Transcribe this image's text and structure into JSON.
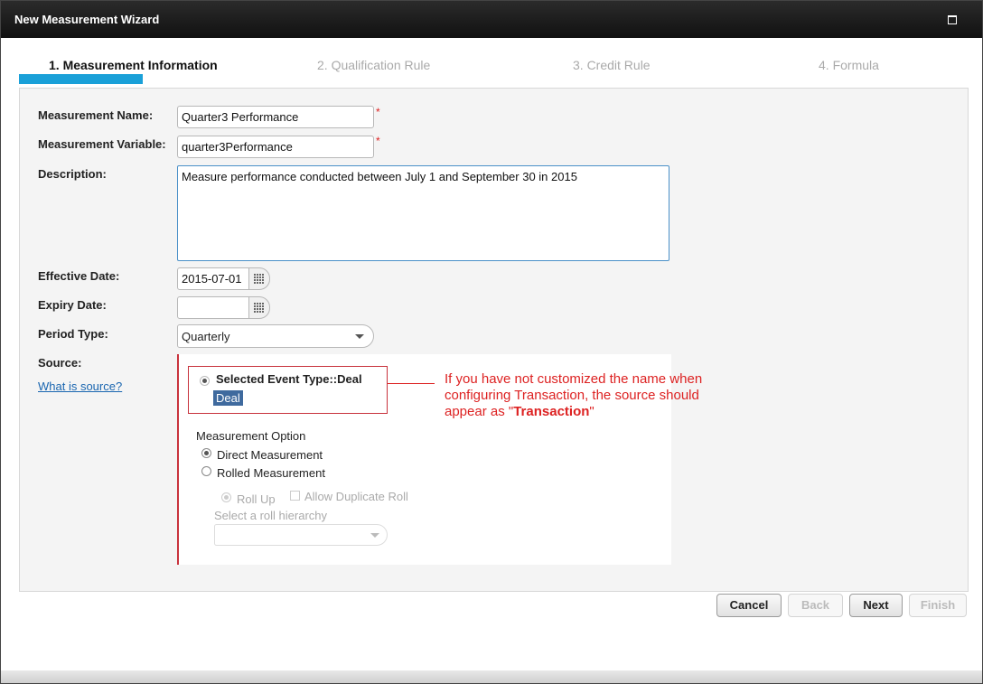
{
  "window": {
    "title": "New Measurement Wizard"
  },
  "steps": [
    {
      "label": "1. Measurement Information",
      "active": true
    },
    {
      "label": "2. Qualification Rule",
      "active": false
    },
    {
      "label": "3. Credit Rule",
      "active": false
    },
    {
      "label": "4. Formula",
      "active": false
    }
  ],
  "form": {
    "measurement_name": {
      "label": "Measurement Name:",
      "value": "Quarter3 Performance",
      "required_mark": "*"
    },
    "measurement_variable": {
      "label": "Measurement Variable:",
      "value": "quarter3Performance",
      "required_mark": "*"
    },
    "description": {
      "label": "Description:",
      "value": "Measure performance conducted between July 1 and September 30 in 2015"
    },
    "effective_date": {
      "label": "Effective Date:",
      "value": "2015-07-01"
    },
    "expiry_date": {
      "label": "Expiry Date:",
      "value": ""
    },
    "period_type": {
      "label": "Period Type:",
      "value": "Quarterly"
    },
    "source": {
      "label": "Source:",
      "help_link": "What is source?",
      "selected_event": "Selected Event Type::Deal",
      "event_badge": "Deal"
    },
    "measurement_option": {
      "label": "Measurement Option",
      "direct": "Direct Measurement",
      "rolled": "Rolled Measurement",
      "roll_up": "Roll Up",
      "allow_duplicate": "Allow Duplicate Roll",
      "hierarchy_label": "Select a roll hierarchy",
      "hierarchy_value": ""
    }
  },
  "annotation": {
    "line1": "If you have not customized the name when",
    "line2": "configuring Transaction, the source should",
    "line3_prefix": "appear as \"",
    "line3_bold": "Transaction",
    "line3_suffix": "\""
  },
  "buttons": {
    "cancel": "Cancel",
    "back": "Back",
    "next": "Next",
    "finish": "Finish"
  },
  "colors": {
    "accent": "#1aa0d8",
    "annotation": "#dd2222",
    "titlebar": "#1a1a1a"
  }
}
